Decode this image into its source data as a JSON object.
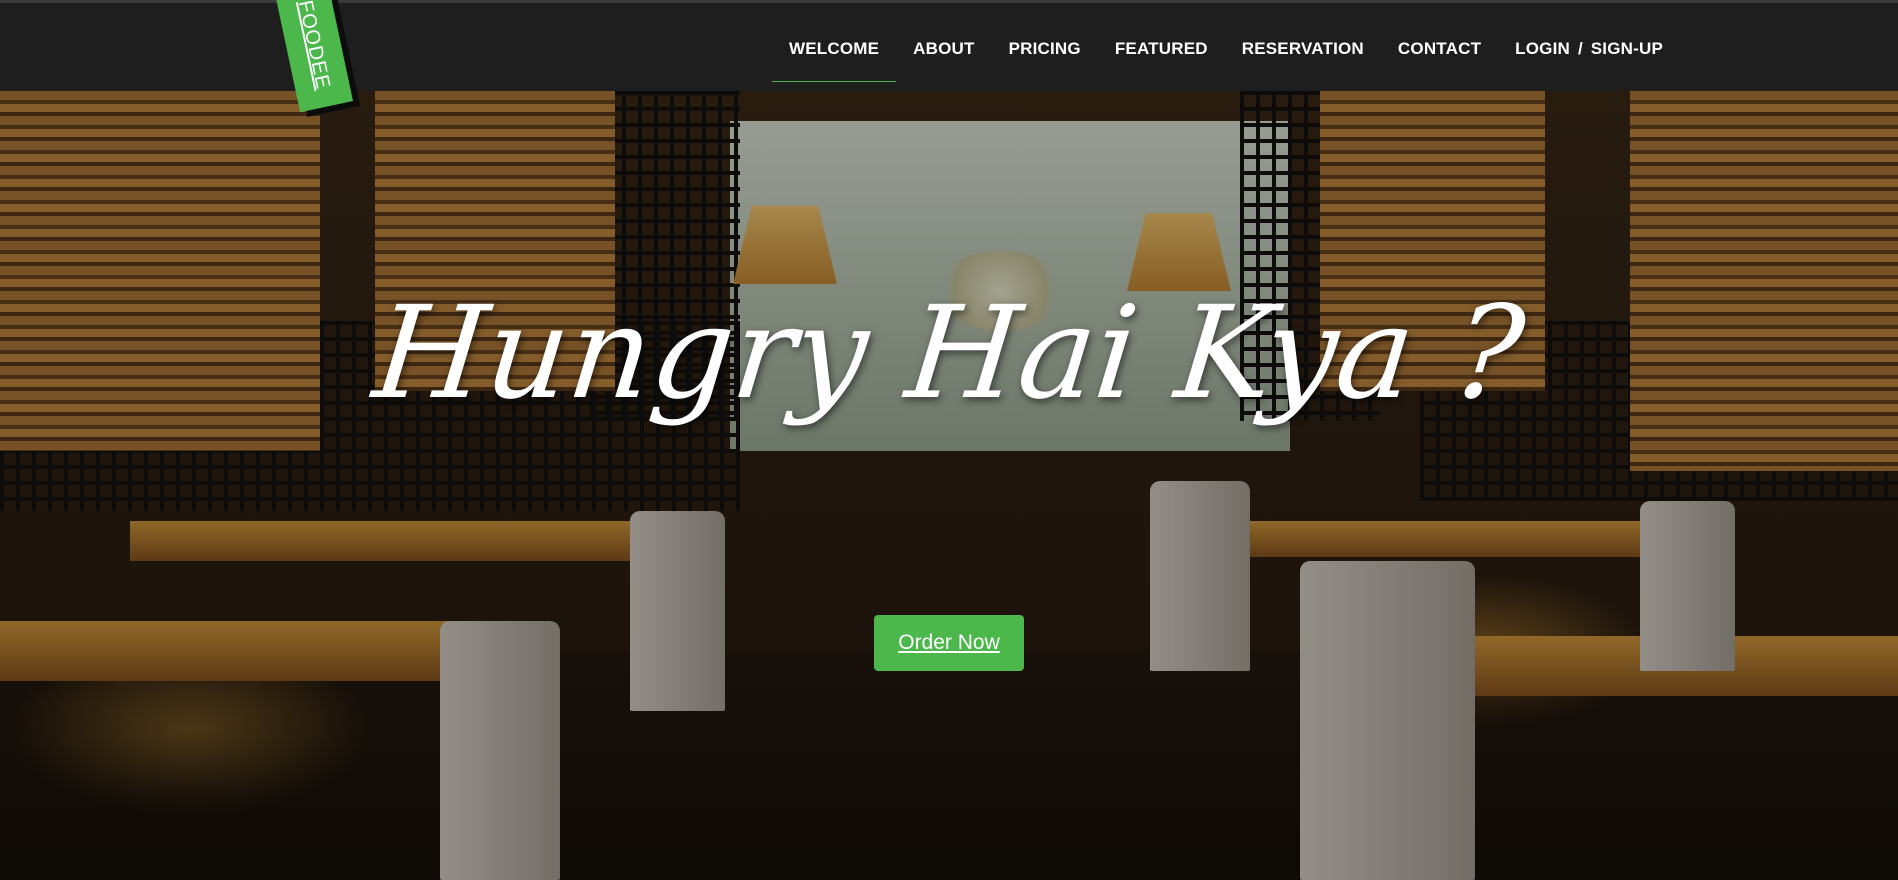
{
  "logo": {
    "text": "FOODEE"
  },
  "nav": {
    "items": [
      {
        "label": "WELCOME",
        "active": true
      },
      {
        "label": "ABOUT"
      },
      {
        "label": "PRICING"
      },
      {
        "label": "FEATURED"
      },
      {
        "label": "RESERVATION"
      },
      {
        "label": "CONTACT"
      }
    ],
    "login": "LOGIN",
    "separator": "/",
    "signup": "SIGN-UP"
  },
  "hero": {
    "headline": "Hungry Hai Kya ?",
    "cta_label": "Order Now"
  },
  "colors": {
    "accent": "#4cb84c",
    "topbar": "#1e1e1e",
    "text": "#ffffff"
  }
}
